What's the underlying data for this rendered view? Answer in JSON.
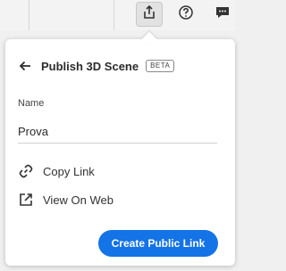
{
  "toolbar": {
    "share_icon": "share-upload-icon",
    "help_icon": "help-circle-icon",
    "comments_icon": "comment-bubble-icon"
  },
  "publish_panel": {
    "back_icon": "arrow-left-icon",
    "title": "Publish 3D Scene",
    "badge": "BETA",
    "name_label": "Name",
    "name_value": "Prova",
    "copy_link_label": "Copy Link",
    "copy_link_icon": "link-icon",
    "view_on_web_label": "View On Web",
    "view_on_web_icon": "external-link-icon",
    "create_button_label": "Create Public Link"
  },
  "colors": {
    "accent": "#1473e6",
    "panel_bg": "#ffffff",
    "toolbar_bg": "#f3f3f3"
  }
}
